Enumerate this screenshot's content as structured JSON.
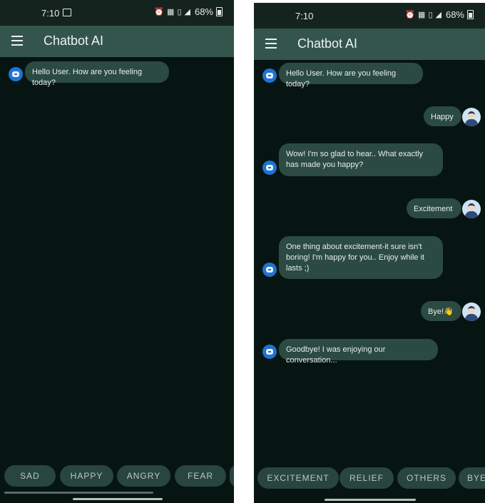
{
  "left": {
    "status": {
      "time": "7:10",
      "battery": "68%"
    },
    "appbar": {
      "title": "Chatbot AI"
    },
    "messages": [
      {
        "from": "bot",
        "text": "Hello User. How are you feeling today?"
      }
    ],
    "chips": [
      "SAD",
      "HAPPY",
      "ANGRY",
      "FEAR"
    ]
  },
  "right": {
    "status": {
      "time": "7:10",
      "battery": "68%"
    },
    "appbar": {
      "title": "Chatbot AI"
    },
    "messages": [
      {
        "from": "bot",
        "text": "Hello User. How are you feeling today?"
      },
      {
        "from": "user",
        "text": "Happy"
      },
      {
        "from": "bot",
        "text": "Wow! I'm so glad to hear.. What exactly has made you happy?"
      },
      {
        "from": "user",
        "text": "Excitement"
      },
      {
        "from": "bot",
        "text": "One thing about excitement-it sure isn't boring! I'm happy for you.. Enjoy while it lasts ;)"
      },
      {
        "from": "user",
        "text": "Bye!👋"
      },
      {
        "from": "bot",
        "text": "Goodbye! I was enjoying our conversation..."
      }
    ],
    "chips": [
      "EXCITEMENT",
      "RELIEF",
      "OTHERS",
      "BYE"
    ]
  },
  "icons": {
    "menu": "hamburger-menu-icon",
    "bot_avatar": "robot-icon",
    "user_avatar": "user-person-icon",
    "alarm": "alarm-clock-icon",
    "vibrate": "vibrate-icon",
    "signal": "signal-icon",
    "battery": "battery-icon"
  },
  "colors": {
    "background": "#071512",
    "appbar": "#33554c",
    "bubble": "#2a4a42",
    "chip": "#284540",
    "bot_avatar": "#1e73d4"
  }
}
